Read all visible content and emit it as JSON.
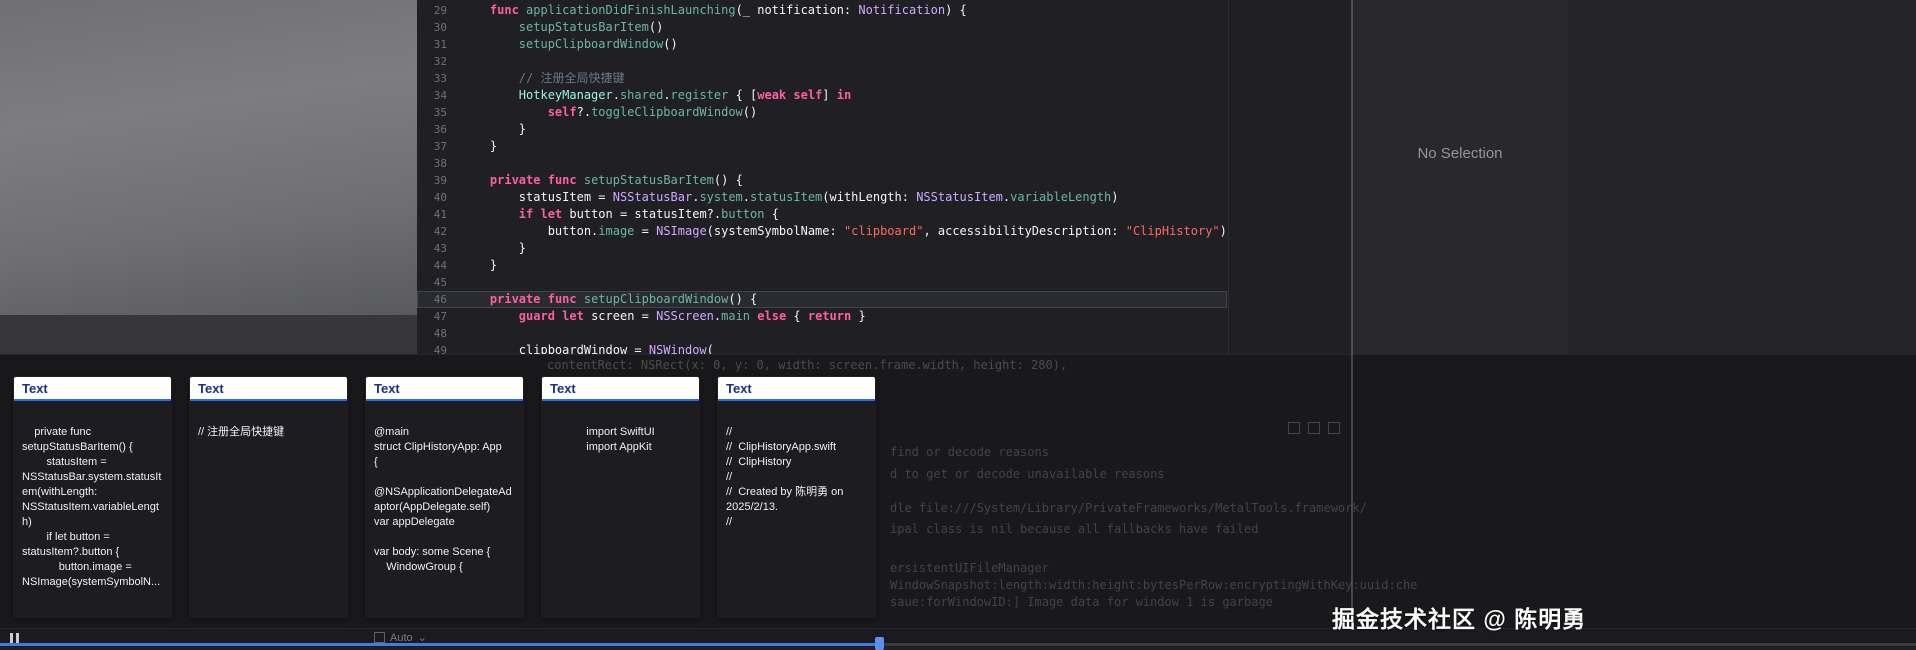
{
  "xcode": {
    "editor": {
      "highlight_line": 46,
      "token_colors": {
        "plain": "#F5F5F7",
        "keyword": "#FC5FA3",
        "type": "#D0A8FF",
        "project_type": "#9EF1DD",
        "method": "#67B7A4",
        "string": "#FC6A5D",
        "comment": "#6C7986",
        "background": "#1F1F24"
      },
      "lines": [
        {
          "n": 29,
          "seg": [
            [
              "p",
              "    "
            ],
            [
              "k",
              "func"
            ],
            [
              "p",
              " "
            ],
            [
              "f",
              "applicationDidFinishLaunching"
            ],
            [
              "p",
              "(_ notification: "
            ],
            [
              "t",
              "Notification"
            ],
            [
              "p",
              ") {"
            ]
          ]
        },
        {
          "n": 30,
          "seg": [
            [
              "p",
              "        "
            ],
            [
              "f",
              "setupStatusBarItem"
            ],
            [
              "p",
              "()"
            ]
          ]
        },
        {
          "n": 31,
          "seg": [
            [
              "p",
              "        "
            ],
            [
              "f",
              "setupClipboardWindow"
            ],
            [
              "p",
              "()"
            ]
          ]
        },
        {
          "n": 32,
          "seg": []
        },
        {
          "n": 33,
          "seg": [
            [
              "p",
              "        "
            ],
            [
              "c",
              "// 注册全局快捷键"
            ]
          ]
        },
        {
          "n": 34,
          "seg": [
            [
              "p",
              "        "
            ],
            [
              "pt",
              "HotkeyManager"
            ],
            [
              "p",
              "."
            ],
            [
              "f",
              "shared"
            ],
            [
              "p",
              "."
            ],
            [
              "f",
              "register"
            ],
            [
              "p",
              " { ["
            ],
            [
              "k",
              "weak"
            ],
            [
              "p",
              " "
            ],
            [
              "k",
              "self"
            ],
            [
              "p",
              "] "
            ],
            [
              "k",
              "in"
            ]
          ]
        },
        {
          "n": 35,
          "seg": [
            [
              "p",
              "            "
            ],
            [
              "k",
              "self"
            ],
            [
              "p",
              "?."
            ],
            [
              "f",
              "toggleClipboardWindow"
            ],
            [
              "p",
              "()"
            ]
          ]
        },
        {
          "n": 36,
          "seg": [
            [
              "p",
              "        }"
            ]
          ]
        },
        {
          "n": 37,
          "seg": [
            [
              "p",
              "    }"
            ]
          ]
        },
        {
          "n": 38,
          "seg": []
        },
        {
          "n": 39,
          "seg": [
            [
              "p",
              "    "
            ],
            [
              "k",
              "private"
            ],
            [
              "p",
              " "
            ],
            [
              "k",
              "func"
            ],
            [
              "p",
              " "
            ],
            [
              "f",
              "setupStatusBarItem"
            ],
            [
              "p",
              "() {"
            ]
          ]
        },
        {
          "n": 40,
          "seg": [
            [
              "p",
              "        statusItem = "
            ],
            [
              "t",
              "NSStatusBar"
            ],
            [
              "p",
              "."
            ],
            [
              "f",
              "system"
            ],
            [
              "p",
              "."
            ],
            [
              "f",
              "statusItem"
            ],
            [
              "p",
              "(withLength: "
            ],
            [
              "t",
              "NSStatusItem"
            ],
            [
              "p",
              "."
            ],
            [
              "f",
              "variableLength"
            ],
            [
              "p",
              ")"
            ]
          ]
        },
        {
          "n": 41,
          "seg": [
            [
              "p",
              "        "
            ],
            [
              "k",
              "if"
            ],
            [
              "p",
              " "
            ],
            [
              "k",
              "let"
            ],
            [
              "p",
              " button = statusItem?."
            ],
            [
              "f",
              "button"
            ],
            [
              "p",
              " {"
            ]
          ]
        },
        {
          "n": 42,
          "seg": [
            [
              "p",
              "            button."
            ],
            [
              "f",
              "image"
            ],
            [
              "p",
              " = "
            ],
            [
              "t",
              "NSImage"
            ],
            [
              "p",
              "(systemSymbolName: "
            ],
            [
              "s",
              "\"clipboard\""
            ],
            [
              "p",
              ", accessibilityDescription: "
            ],
            [
              "s",
              "\"ClipHistory\""
            ],
            [
              "p",
              ")"
            ]
          ]
        },
        {
          "n": 43,
          "seg": [
            [
              "p",
              "        }"
            ]
          ]
        },
        {
          "n": 44,
          "seg": [
            [
              "p",
              "    }"
            ]
          ]
        },
        {
          "n": 45,
          "seg": []
        },
        {
          "n": 46,
          "seg": [
            [
              "p",
              "    "
            ],
            [
              "k",
              "private"
            ],
            [
              "p",
              " "
            ],
            [
              "k",
              "func"
            ],
            [
              "p",
              " "
            ],
            [
              "f",
              "setupClipboardWindow"
            ],
            [
              "p",
              "() {"
            ]
          ]
        },
        {
          "n": 47,
          "seg": [
            [
              "p",
              "        "
            ],
            [
              "k",
              "guard"
            ],
            [
              "p",
              " "
            ],
            [
              "k",
              "let"
            ],
            [
              "p",
              " screen = "
            ],
            [
              "t",
              "NSScreen"
            ],
            [
              "p",
              "."
            ],
            [
              "f",
              "main"
            ],
            [
              "p",
              " "
            ],
            [
              "k",
              "else"
            ],
            [
              "p",
              " { "
            ],
            [
              "k",
              "return"
            ],
            [
              "p",
              " }"
            ]
          ]
        },
        {
          "n": 48,
          "seg": []
        },
        {
          "n": 49,
          "seg": [
            [
              "p",
              "        clipboardWindow = "
            ],
            [
              "t",
              "NSWindow"
            ],
            [
              "p",
              "("
            ]
          ]
        }
      ],
      "ghost_line": "contentRect: NSRect(x: 0, y: 0, width: screen.frame.width, height: 280),"
    },
    "inspector": {
      "empty_text": "No Selection"
    },
    "console": {
      "lines": [
        "find or decode reasons",
        "d to get or decode unavailable reasons",
        "dle file:///System/Library/PrivateFrameworks/MetalTools.framework/",
        "ipal class is nil because all fallbacks have failed",
        "ersistentUIFileManager",
        "WindowSnapshot:length:width:height:bytesPerRow:encryptingWithKey:uuid:che",
        "saue:forWindowID:] Image data for window 1 is garbage"
      ]
    },
    "debug_bar": {
      "scope_label": "Auto"
    }
  },
  "clipboard_window": {
    "cards": [
      {
        "title": "Text",
        "body": "    private func setupStatusBarItem() {\n        statusItem = NSStatusBar.system.statusItem(withLength: NSStatusItem.variableLength)\n        if let button = statusItem?.button {\n            button.image = NSImage(systemSymbolN..."
      },
      {
        "title": "Text",
        "body": "// 注册全局快捷键"
      },
      {
        "title": "Text",
        "body": "@main\nstruct ClipHistoryApp: App\n{\n\n@NSApplicationDelegateAdaptor(AppDelegate.self)\nvar appDelegate\n\nvar body: some Scene {\n    WindowGroup {"
      },
      {
        "title": "Text",
        "body": "import SwiftUI\nimport AppKit"
      },
      {
        "title": "Text",
        "body": "//\n//  ClipHistoryApp.swift\n//  ClipHistory\n//\n//  Created by 陈明勇 on 2025/2/13.\n//"
      }
    ],
    "accent_color": "#2A6DF5"
  },
  "player": {
    "progress_percent": 46,
    "accent_color": "#3F7BE0"
  },
  "watermark": "掘金技术社区 @ 陈明勇"
}
